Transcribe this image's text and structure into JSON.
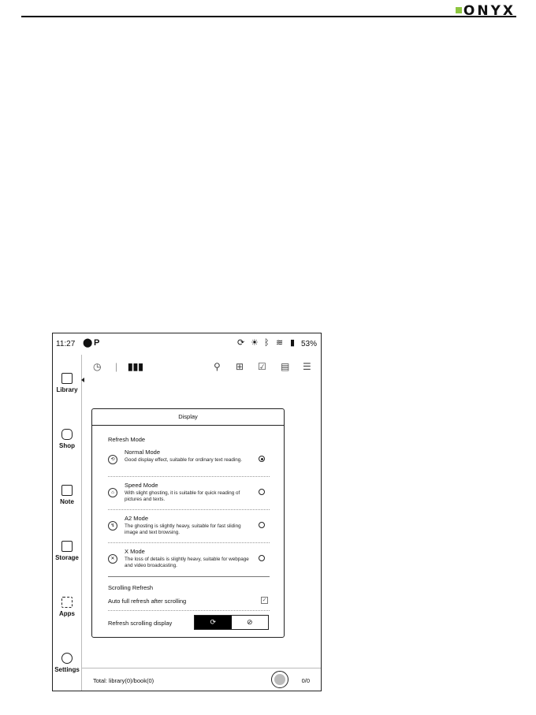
{
  "brand": {
    "name": "ONYX"
  },
  "status": {
    "time": "11:27",
    "battery_pct": "53%",
    "icons": [
      "shield-icon",
      "p-badge-icon",
      "sync-icon",
      "bulb-icon",
      "bluetooth-icon",
      "wifi-icon",
      "battery-icon"
    ]
  },
  "sidebar": {
    "items": [
      {
        "label": "Library",
        "icon": "library-icon"
      },
      {
        "label": "Shop",
        "icon": "shop-icon"
      },
      {
        "label": "Note",
        "icon": "note-icon"
      },
      {
        "label": "Storage",
        "icon": "storage-icon"
      },
      {
        "label": "Apps",
        "icon": "apps-icon"
      },
      {
        "label": "Settings",
        "icon": "settings-icon"
      }
    ]
  },
  "dialog": {
    "title": "Display",
    "refresh_header": "Refresh Mode",
    "modes": [
      {
        "name": "Normal Mode",
        "desc": "Good display effect, suitable for ordinary text reading.",
        "selected": true
      },
      {
        "name": "Speed Mode",
        "desc": "With slight ghosting, it is suitable for quick reading of pictures and texts.",
        "selected": false
      },
      {
        "name": "A2 Mode",
        "desc": "The ghosting is slightly heavy, suitable for fast sliding image and text browsing.",
        "selected": false
      },
      {
        "name": "X Mode",
        "desc": "The loss of details is slightly heavy, suitable for webpage and video broadcasting.",
        "selected": false
      }
    ],
    "scroll_header": "Scrolling Refresh",
    "auto_label": "Auto full refresh after scrolling",
    "display_label": "Refresh scrolling display"
  },
  "footer": {
    "total": "Total: library(0)/book(0)",
    "page": "0/0"
  }
}
